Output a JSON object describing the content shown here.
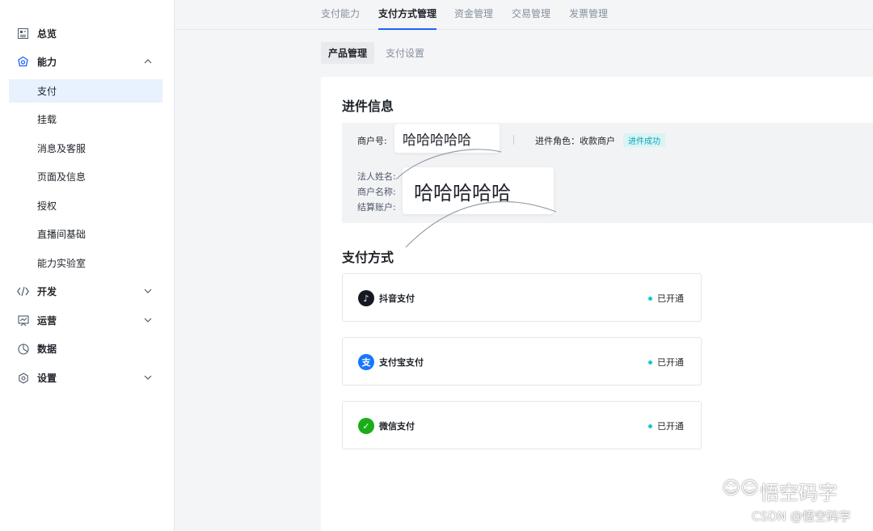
{
  "sidebar": {
    "items": [
      {
        "label": "总览",
        "icon": "dashboard-icon"
      },
      {
        "label": "能力",
        "icon": "capability-icon",
        "expanded": true
      },
      {
        "label": "开发",
        "icon": "code-icon"
      },
      {
        "label": "运营",
        "icon": "operations-icon"
      },
      {
        "label": "数据",
        "icon": "data-icon"
      },
      {
        "label": "设置",
        "icon": "settings-icon"
      }
    ],
    "sub_items": [
      "支付",
      "挂载",
      "消息及客服",
      "页面及信息",
      "授权",
      "直播间基础",
      "能力实验室"
    ]
  },
  "top_tabs": [
    "支付能力",
    "支付方式管理",
    "资金管理",
    "交易管理",
    "发票管理"
  ],
  "sub_tabs": [
    "产品管理",
    "支付设置"
  ],
  "info": {
    "title": "进件信息",
    "merchant_no_label": "商户号:",
    "merchant_no_value": "哈哈哈哈哈",
    "role_label": "进件角色：收款商户",
    "status_badge": "进件成功",
    "legal_name_label": "法人姓名:",
    "merchant_name_label": "商户名称:",
    "settlement_label": "结算账户:",
    "name_value": "哈哈哈哈哈"
  },
  "payment": {
    "title": "支付方式",
    "methods": [
      {
        "name": "抖音支付",
        "status": "已开通",
        "icon": "douyin-icon",
        "color": "#161823",
        "glyph": "♪"
      },
      {
        "name": "支付宝支付",
        "status": "已开通",
        "icon": "alipay-icon",
        "color": "#1677ff",
        "glyph": "支"
      },
      {
        "name": "微信支付",
        "status": "已开通",
        "icon": "wechat-pay-icon",
        "color": "#1aad19",
        "glyph": "✓"
      }
    ]
  },
  "watermark": {
    "brand": "悟空码字",
    "source": "CSDN @悟空码字"
  },
  "colors": {
    "accent": "#1664ff",
    "success": "#14c9c9",
    "active_bg": "#e8f1fe"
  }
}
